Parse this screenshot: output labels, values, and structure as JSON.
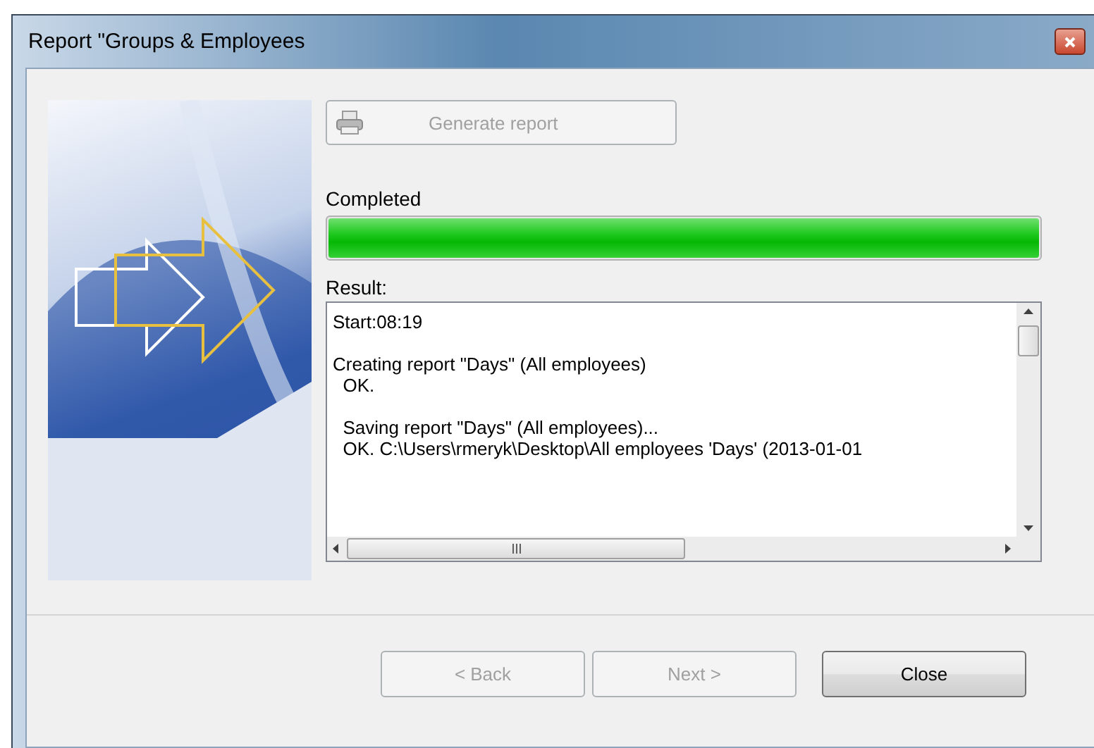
{
  "window": {
    "title": "Report \"Groups & Employees"
  },
  "generate_button": {
    "label": "Generate report",
    "disabled": true
  },
  "progress": {
    "label": "Completed",
    "level": 1
  },
  "result": {
    "label": "Result:",
    "blocks": [
      [
        "Start:08:19"
      ],
      [
        "Creating report \"Days\" (All employees)",
        "  OK."
      ],
      [
        "  Saving report \"Days\" (All employees)...",
        "  OK. C:\\Users\\rmeryk\\Desktop\\All employees 'Days' (2013-01-01"
      ]
    ]
  },
  "buttons": [
    {
      "label": "< Back",
      "disabled": true
    },
    {
      "label": "Next >",
      "disabled": true
    },
    {
      "label": "Close",
      "disabled": false
    }
  ]
}
